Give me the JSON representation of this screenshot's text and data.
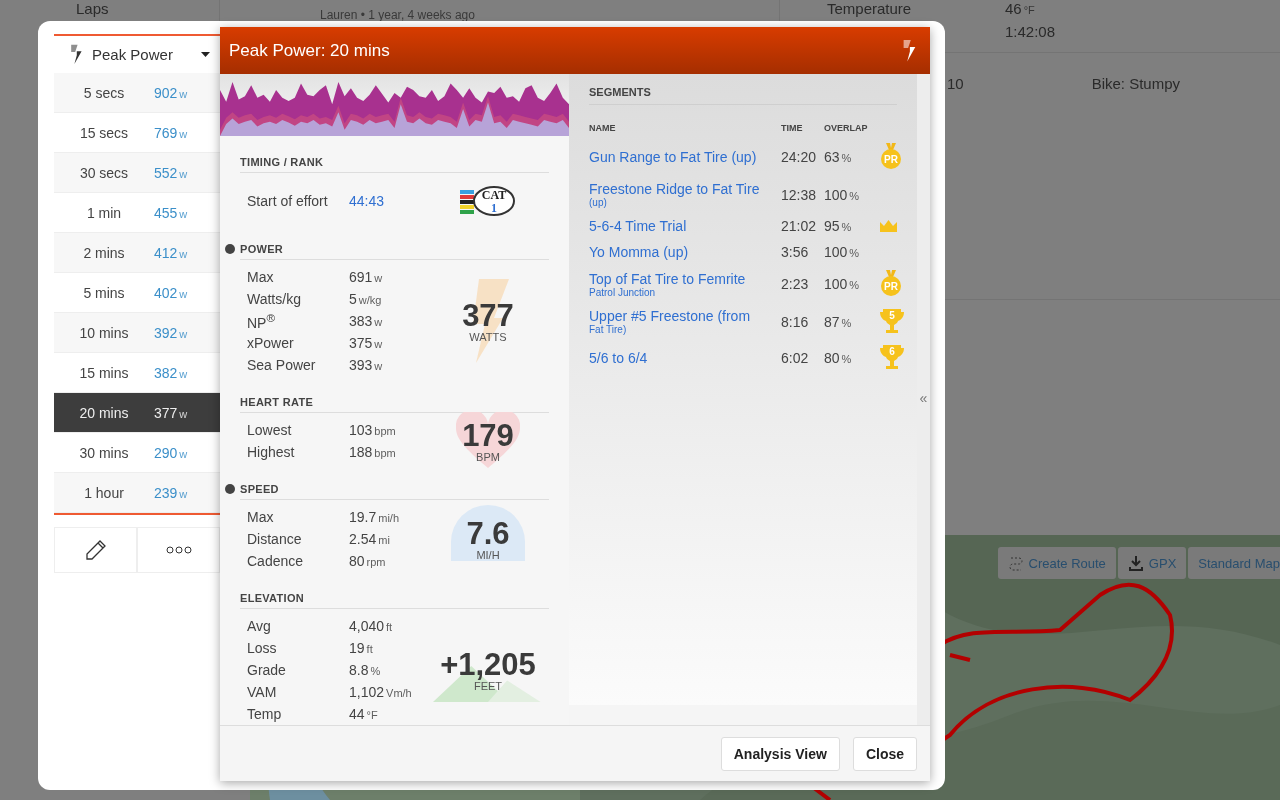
{
  "background": {
    "laps_label": "Laps",
    "activity_author": "Lauren • 1 year, 4 weeks ago",
    "weather": [
      {
        "label": "Temperature",
        "value": "46",
        "unit": "°F"
      },
      {
        "value": "1:42:08"
      }
    ],
    "gear": [
      {
        "value": "10"
      },
      {
        "value": "Bike: Stumpy"
      }
    ],
    "map": {
      "kind": "picture",
      "buttons": [
        {
          "kind": "route",
          "label": "Create Route"
        },
        {
          "kind": "download",
          "label": "GPX"
        },
        {
          "kind": "plain",
          "label": "Standard Map"
        }
      ]
    }
  },
  "sidebar": {
    "dropdown": "Peak Power",
    "items": [
      {
        "label": "5 secs",
        "value": "902",
        "unit": "w",
        "selected": false
      },
      {
        "label": "15 secs",
        "value": "769",
        "unit": "w",
        "selected": false
      },
      {
        "label": "30 secs",
        "value": "552",
        "unit": "w",
        "selected": false
      },
      {
        "label": "1 min",
        "value": "455",
        "unit": "w",
        "selected": false
      },
      {
        "label": "2 mins",
        "value": "412",
        "unit": "w",
        "selected": false
      },
      {
        "label": "5 mins",
        "value": "402",
        "unit": "w",
        "selected": false
      },
      {
        "label": "10 mins",
        "value": "392",
        "unit": "w",
        "selected": false
      },
      {
        "label": "15 mins",
        "value": "382",
        "unit": "w",
        "selected": false
      },
      {
        "label": "20 mins",
        "value": "377",
        "unit": "w",
        "selected": true
      },
      {
        "label": "30 mins",
        "value": "290",
        "unit": "w",
        "selected": false
      },
      {
        "label": "1 hour",
        "value": "239",
        "unit": "w",
        "selected": false
      }
    ],
    "actions": [
      {
        "kind": "edit"
      },
      {
        "kind": "more"
      }
    ]
  },
  "dialog": {
    "title": "Peak Power: 20 mins",
    "sections": [
      {
        "kind": "cat",
        "title": "TIMING / RANK",
        "marker": false,
        "rows": [
          {
            "label": "Start of effort",
            "value": "44:43",
            "link": true
          }
        ],
        "badge": {
          "value": "CAT",
          "unit": "1"
        }
      },
      {
        "kind": "bolt",
        "title": "POWER",
        "marker": true,
        "rows": [
          {
            "label": "Max",
            "value": "691",
            "unit": "w"
          },
          {
            "label": "Watts/kg",
            "value": "5",
            "unit": "w/kg"
          },
          {
            "label": "NP$^{®}$",
            "value": "383",
            "unit": "w"
          },
          {
            "label": "xPower",
            "value": "375",
            "unit": "w"
          },
          {
            "label": "Sea Power",
            "value": "393",
            "unit": "w"
          }
        ],
        "badge": {
          "value": "377",
          "unit": "WATTS"
        }
      },
      {
        "kind": "heart",
        "title": "HEART RATE",
        "marker": false,
        "rows": [
          {
            "label": "Lowest",
            "value": "103",
            "unit": "bpm"
          },
          {
            "label": "Highest",
            "value": "188",
            "unit": "bpm"
          }
        ],
        "badge": {
          "value": "179",
          "unit": "BPM"
        }
      },
      {
        "kind": "dome",
        "title": "SPEED",
        "marker": true,
        "rows": [
          {
            "label": "Max",
            "value": "19.7",
            "unit": "mi/h"
          },
          {
            "label": "Distance",
            "value": "2.54",
            "unit": "mi"
          },
          {
            "label": "Cadence",
            "value": "80",
            "unit": "rpm"
          }
        ],
        "badge": {
          "value": "7.6",
          "unit": "MI/H"
        }
      },
      {
        "kind": "mountain",
        "title": "ELEVATION",
        "marker": false,
        "rows": [
          {
            "label": "Avg",
            "value": "4,040",
            "unit": "ft"
          },
          {
            "label": "Loss",
            "value": "19",
            "unit": "ft"
          },
          {
            "label": "Grade",
            "value": "8.8",
            "unit": "%"
          },
          {
            "label": "VAM",
            "value": "1,102",
            "unit": "Vm/h"
          },
          {
            "label": "Temp",
            "value": "44",
            "unit": "°F"
          }
        ],
        "badge": {
          "value": "+1,205",
          "unit": "FEET"
        }
      }
    ],
    "segments": {
      "title": "SEGMENTS",
      "columns": [
        "NAME",
        "TIME",
        "OVERLAP"
      ],
      "rows": [
        {
          "name": "Gun Range to Fat Tire (up)",
          "time": "24:20",
          "overlap": "63",
          "unit": "%",
          "award": {
            "kind": "medal",
            "label": "PR"
          }
        },
        {
          "name": "Freestone Ridge to Fat Tire",
          "sub": "(up)",
          "time": "12:38",
          "overlap": "100",
          "unit": "%"
        },
        {
          "name": "5-6-4 Time Trial",
          "time": "21:02",
          "overlap": "95",
          "unit": "%",
          "award": {
            "kind": "crown"
          }
        },
        {
          "name": "Yo Momma (up)",
          "time": "3:56",
          "overlap": "100",
          "unit": "%"
        },
        {
          "name": "Top of Fat Tire to Femrite",
          "sub": "Patrol Junction",
          "time": "2:23",
          "overlap": "100",
          "unit": "%",
          "award": {
            "kind": "medal",
            "label": "PR"
          }
        },
        {
          "name": "Upper #5 Freestone (from",
          "sub": "Fat Tire)",
          "time": "8:16",
          "overlap": "87",
          "unit": "%",
          "award": {
            "kind": "trophy",
            "label": "5"
          }
        },
        {
          "name": "5/6 to 6/4",
          "time": "6:02",
          "overlap": "80",
          "unit": "%",
          "award": {
            "kind": "trophy",
            "label": "6"
          }
        }
      ]
    },
    "collapse": "«",
    "buttons": [
      "Analysis View",
      "Close"
    ]
  }
}
